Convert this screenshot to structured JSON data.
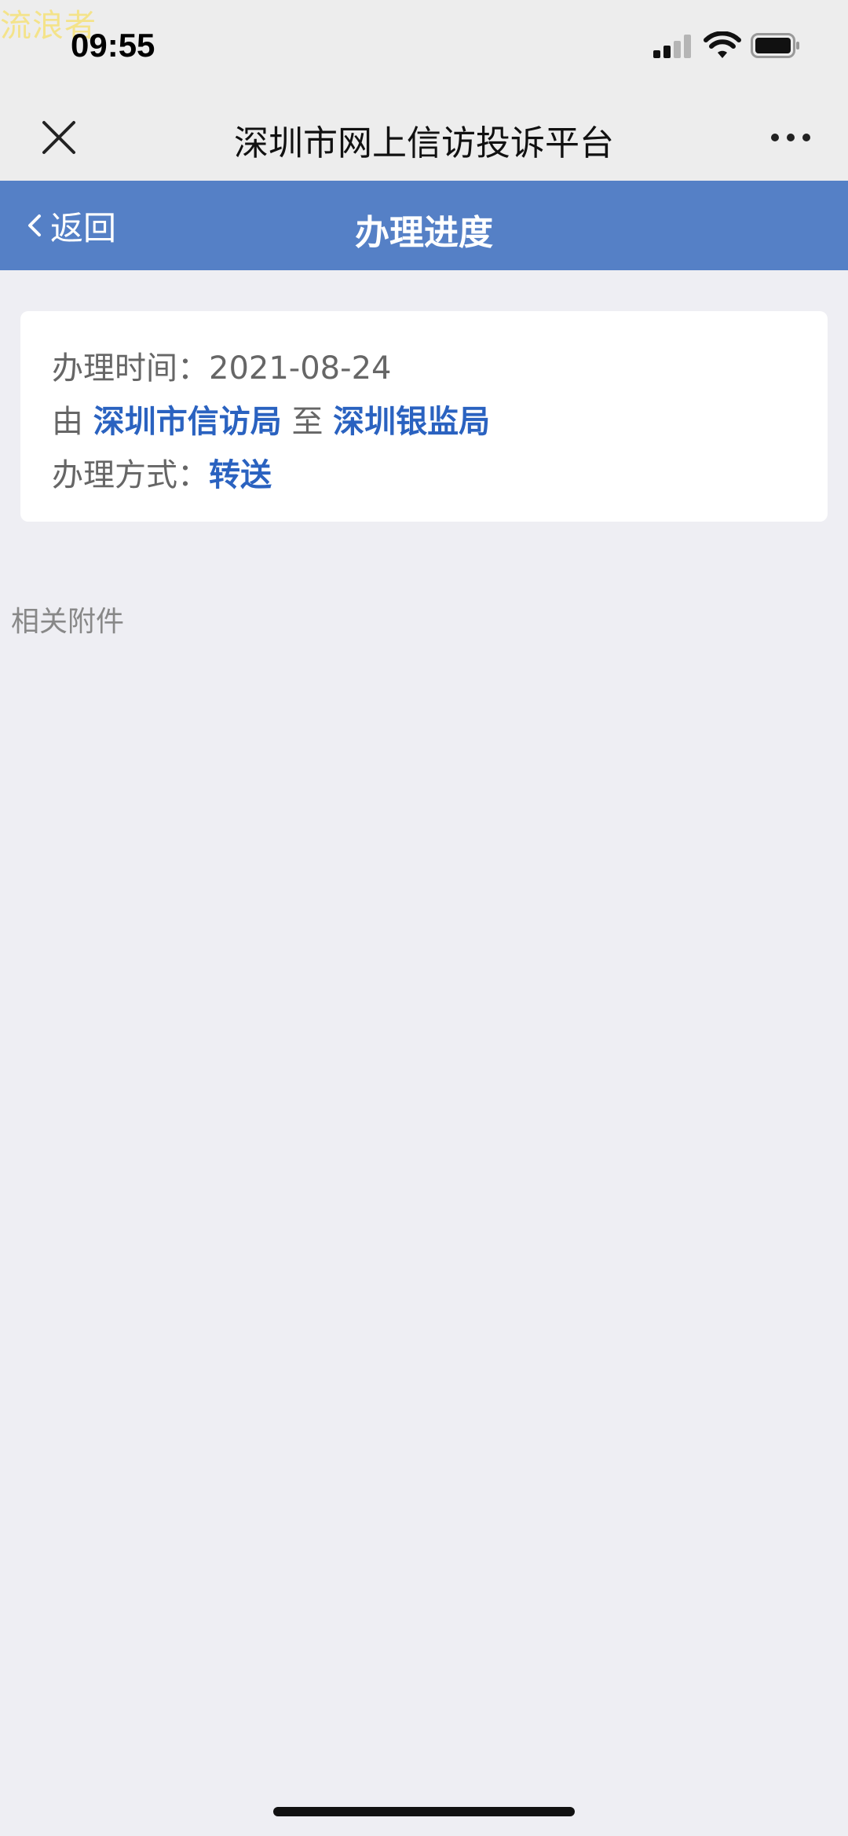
{
  "status_bar": {
    "watermark": "流浪者",
    "time": "09:55"
  },
  "header": {
    "title": "深圳市网上信访投诉平台"
  },
  "nav": {
    "back_label": "返回",
    "title": "办理进度",
    "color": "#5580c6"
  },
  "progress": {
    "time_label": "办理时间：",
    "time_value": "2021-08-24",
    "from_prefix": "由",
    "from_org": "深圳市信访局",
    "to_connector": "至",
    "to_org": "深圳银监局",
    "method_label": "办理方式：",
    "method_value": "转送",
    "accent_color": "#2a62c0"
  },
  "attachments": {
    "label": "相关附件"
  }
}
